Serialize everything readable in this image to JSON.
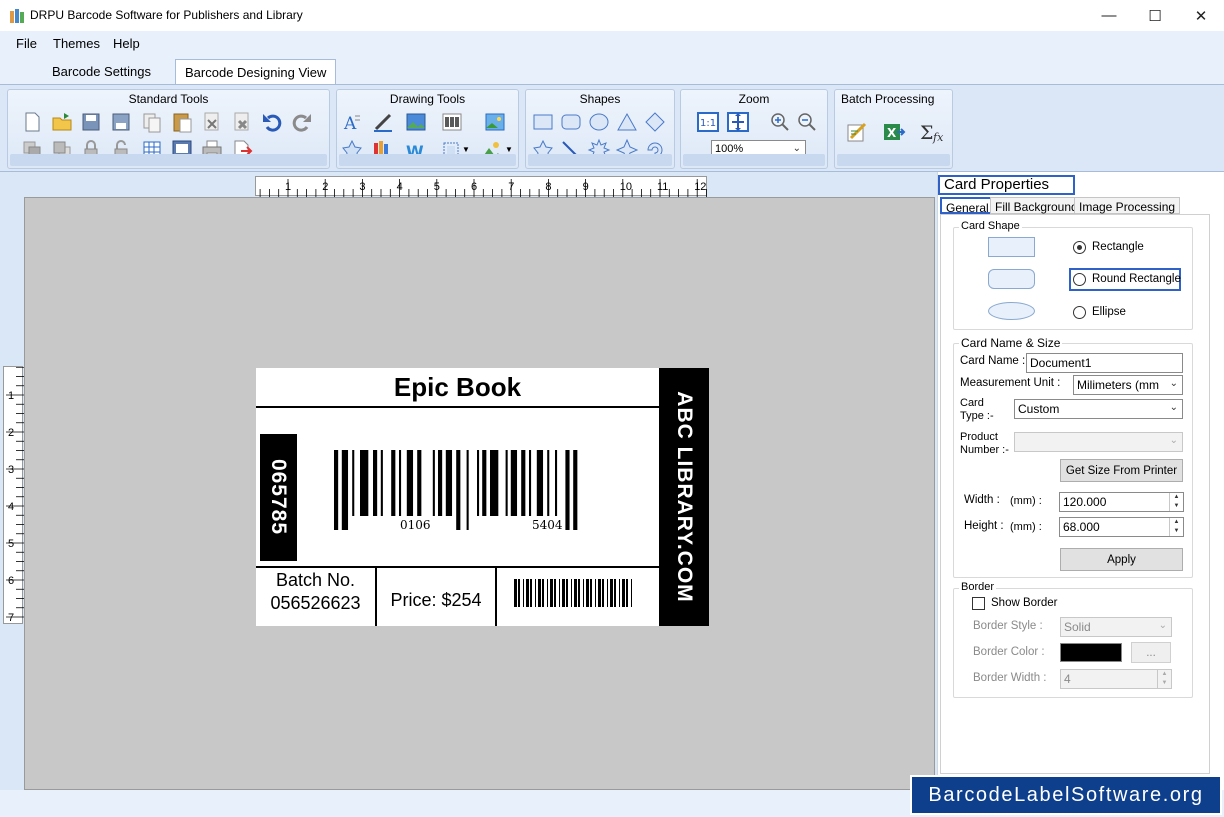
{
  "window": {
    "title": "DRPU Barcode Software for Publishers and Library"
  },
  "menu": [
    "File",
    "Themes",
    "Help"
  ],
  "tabs": [
    "Barcode Settings",
    "Barcode Designing View"
  ],
  "ribbon": {
    "groups": [
      "Standard Tools",
      "Drawing Tools",
      "Shapes",
      "Zoom",
      "Batch Processing"
    ],
    "zoom_value": "100%"
  },
  "rulers": {
    "horizontal": [
      "1",
      "2",
      "3",
      "4",
      "5",
      "6",
      "7",
      "8",
      "9",
      "10",
      "11",
      "12"
    ],
    "vertical": [
      "1",
      "2",
      "3",
      "4",
      "5",
      "6",
      "7"
    ]
  },
  "card": {
    "title": "Epic Book",
    "side_text": "ABC LIBRARY.COM",
    "vertical_number": "065785",
    "barcode_left_digits": "0106",
    "barcode_right_digits": "5404",
    "batch_label": "Batch No.",
    "batch_number": "056526623",
    "price": "Price: $254"
  },
  "properties": {
    "title": "Card Properties",
    "tabs": [
      "General",
      "Fill Background",
      "Image Processing"
    ],
    "card_shape": {
      "legend": "Card Shape",
      "options": [
        "Rectangle",
        "Round Rectangle",
        "Ellipse"
      ],
      "selected": "Rectangle"
    },
    "name_size": {
      "legend": "Card  Name & Size",
      "card_name_label": "Card Name :",
      "card_name_value": "Document1",
      "unit_label": "Measurement Unit :",
      "unit_value": "Milimeters (mm",
      "card_type_label_1": "Card",
      "card_type_label_2": "Type :-",
      "card_type_value": "Custom",
      "product_label_1": "Product",
      "product_label_2": "Number :-",
      "get_size_button": "Get Size From Printer",
      "width_label": "Width :",
      "width_unit": "(mm) :",
      "width_value": "120.000",
      "height_label": "Height :",
      "height_unit": "(mm) :",
      "height_value": "68.000",
      "apply_button": "Apply"
    },
    "border": {
      "legend": "Border",
      "show_border": "Show Border",
      "show_border_checked": false,
      "style_label": "Border Style :",
      "style_value": "Solid",
      "color_label": "Border Color :",
      "color_value": "#000000",
      "color_button": "...",
      "width_label": "Border Width :",
      "width_value": "4"
    }
  },
  "watermark": "BarcodeLabelSoftware.org"
}
